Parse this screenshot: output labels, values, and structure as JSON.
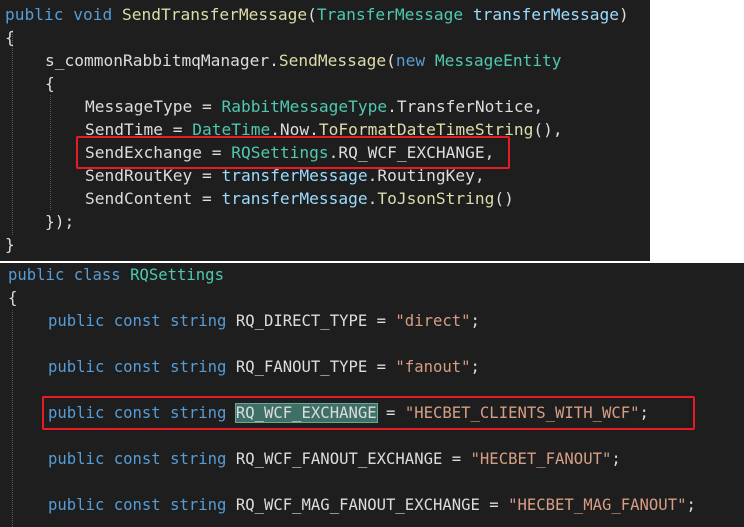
{
  "top": {
    "sig_kw1": "public",
    "sig_kw2": "void",
    "sig_method": "SendTransferMessage",
    "sig_paren_open": "(",
    "sig_param_type": "TransferMessage",
    "sig_param_name": "transferMessage",
    "sig_paren_close": ")",
    "brace_open": "{",
    "call_obj": "s_commonRabbitmqManager.",
    "call_method": "SendMessage",
    "call_paren": "(",
    "call_new": "new",
    "call_type": "MessageEntity",
    "inner_brace_open": "{",
    "f1_name": "MessageType",
    "f1_eq": " = ",
    "f1_type": "RabbitMessageType",
    "f1_rest": ".TransferNotice,",
    "f2_name": "SendTime",
    "f2_eq": " = ",
    "f2_type": "DateTime",
    "f2_mid": ".Now.",
    "f2_method": "ToFormatDateTimeString",
    "f2_rest": "(),",
    "f3_name": "SendExchange",
    "f3_eq": " = ",
    "f3_type": "RQSettings",
    "f3_rest": ".RQ_WCF_EXCHANGE,",
    "f4_name": "SendRoutKey",
    "f4_eq": " = ",
    "f4_var": "transferMessage",
    "f4_rest": ".RoutingKey,",
    "f5_name": "SendContent",
    "f5_eq": " = ",
    "f5_var": "transferMessage",
    "f5_dot": ".",
    "f5_method": "ToJsonString",
    "f5_rest": "()",
    "inner_close": "});",
    "brace_close": "}"
  },
  "bottom": {
    "cls_kw1": "public",
    "cls_kw2": "class",
    "cls_name": "RQSettings",
    "brace_open": "{",
    "const_kw1": "public",
    "const_kw2": "const",
    "const_kw3": "string",
    "c1_name": "RQ_DIRECT_TYPE",
    "c1_eq": " = ",
    "c1_val": "\"direct\"",
    "c1_end": ";",
    "c2_name": "RQ_FANOUT_TYPE",
    "c2_eq": " = ",
    "c2_val": "\"fanout\"",
    "c2_end": ";",
    "c3_name": "RQ_WCF_EXCHANGE",
    "c3_eq": " = ",
    "c3_val": "\"HECBET_CLIENTS_WITH_WCF\"",
    "c3_end": ";",
    "c4_name": "RQ_WCF_FANOUT_EXCHANGE",
    "c4_eq": " = ",
    "c4_val": "\"HECBET_FANOUT\"",
    "c4_end": ";",
    "c5_name": "RQ_WCF_MAG_FANOUT_EXCHANGE",
    "c5_eq": " = ",
    "c5_val": "\"HECBET_MAG_FANOUT\"",
    "c5_end": ";"
  },
  "colors": {
    "background": "#1e1e1e",
    "keyword": "#569cd6",
    "type": "#4ec9b0",
    "method": "#dcdcaa",
    "string": "#d69d85",
    "variable": "#9cdcfe",
    "highlight_box": "#e51c23",
    "selection": "#3f7068"
  }
}
